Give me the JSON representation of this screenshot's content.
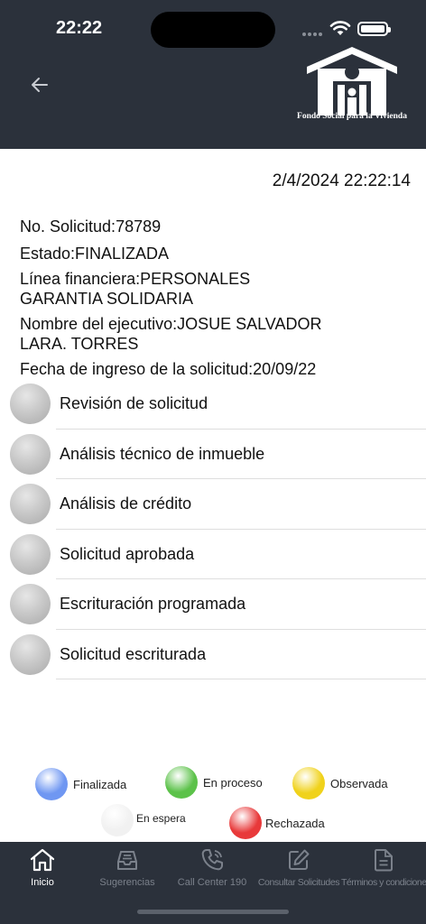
{
  "status_bar": {
    "time": "22:22"
  },
  "header": {
    "logo_text": "Fondo Social para la Vivienda"
  },
  "detail": {
    "datetime": "2/4/2024 22:22:14",
    "fields": [
      {
        "label": "No. Solicitud:",
        "value": "78789"
      },
      {
        "label": "Estado:",
        "value": "FINALIZADA"
      },
      {
        "label": "Línea financiera:",
        "value": "PERSONALES GARANTIA SOLIDARIA"
      },
      {
        "label": "Nombre del ejecutivo:",
        "value": "JOSUE SALVADOR LARA. TORRES"
      },
      {
        "label": "Fecha de ingreso de la solicitud:",
        "value": "20/09/22"
      }
    ]
  },
  "steps": [
    {
      "label": "Revisión de solicitud",
      "status": "En espera"
    },
    {
      "label": "Análisis técnico de inmueble",
      "status": "En espera"
    },
    {
      "label": "Análisis de crédito",
      "status": "En espera"
    },
    {
      "label": "Solicitud aprobada",
      "status": "En espera"
    },
    {
      "label": "Escrituración programada",
      "status": "En espera"
    },
    {
      "label": "Solicitud escriturada",
      "status": "En espera"
    }
  ],
  "legend": [
    {
      "label": "Finalizada",
      "color": "#6f97f2"
    },
    {
      "label": "En proceso",
      "color": "#5cc24a"
    },
    {
      "label": "Observada",
      "color": "#f0d21b"
    },
    {
      "label": "En espera",
      "color": "#f1f1f1"
    },
    {
      "label": "Rechazada",
      "color": "#e8393a"
    }
  ],
  "tabs": [
    {
      "label": "Inicio",
      "icon": "home-icon",
      "active": true
    },
    {
      "label": "Sugerencias",
      "icon": "inbox-icon",
      "active": false
    },
    {
      "label": "Call Center 190",
      "icon": "phone-icon",
      "active": false
    },
    {
      "label": "Consultar Solicitudes",
      "icon": "edit-icon",
      "active": false
    },
    {
      "label": "Términos y condiciones",
      "icon": "document-icon",
      "active": false
    }
  ]
}
